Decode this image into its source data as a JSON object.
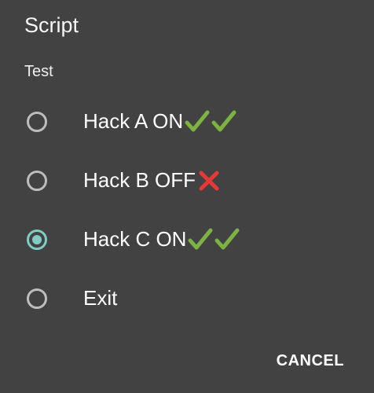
{
  "dialog": {
    "title": "Script",
    "message": "Test",
    "options": [
      {
        "text": "Hack A ON",
        "status_icons": [
          "check-icon",
          "check-icon"
        ],
        "selected": false
      },
      {
        "text": "Hack B OFF",
        "status_icons": [
          "cross-icon"
        ],
        "selected": false
      },
      {
        "text": "Hack C ON",
        "status_icons": [
          "check-icon",
          "check-icon"
        ],
        "selected": true
      },
      {
        "text": "Exit",
        "status_icons": [],
        "selected": false
      }
    ],
    "cancel_label": "CANCEL"
  },
  "colors": {
    "background": "#424242",
    "radio_unchecked": "#bdbdbd",
    "radio_checked": "#80cbc4",
    "check": "#7cb342",
    "cross": "#e53935"
  }
}
